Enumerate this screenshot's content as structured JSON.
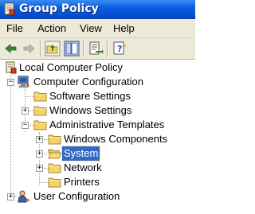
{
  "window": {
    "title": "Group Policy"
  },
  "menu": [
    "File",
    "Action",
    "View",
    "Help"
  ],
  "toolbar": {
    "buttons": [
      "back-icon",
      "forward-icon",
      "up-folder-icon",
      "show-hide-tree-icon",
      "export-list-icon",
      "help-icon"
    ]
  },
  "tree": {
    "root": "Local Computer Policy",
    "computer_config": "Computer Configuration",
    "software_settings": "Software Settings",
    "windows_settings": "Windows Settings",
    "admin_templates": "Administrative Templates",
    "windows_components": "Windows Components",
    "system": "System",
    "network": "Network",
    "printers": "Printers",
    "user_config": "User Configuration",
    "expander_collapsed": "+",
    "expander_expanded": "−"
  },
  "colors": {
    "titlebar": "#0a5fe0",
    "selection": "#316ac5",
    "chrome": "#ece9d8",
    "folder": "#f3d36a"
  }
}
